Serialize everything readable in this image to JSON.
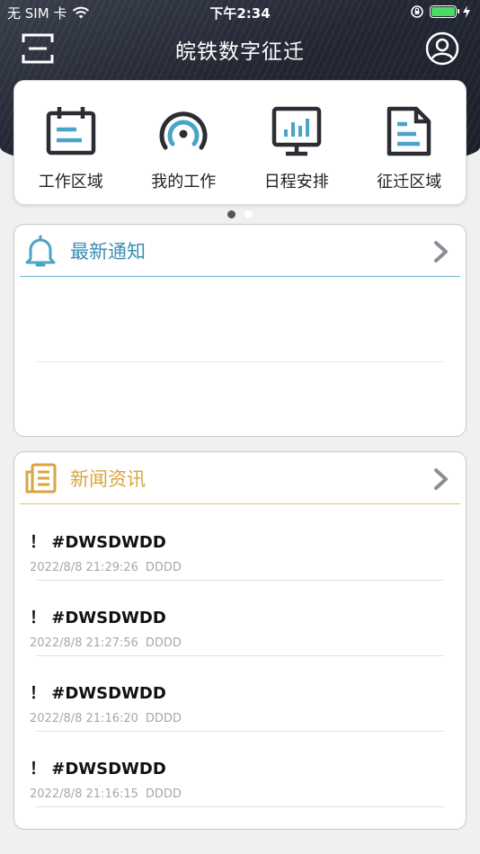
{
  "status_bar": {
    "carrier": "无 SIM 卡",
    "time": "下午2:34"
  },
  "nav": {
    "title": "皖铁数字征迁"
  },
  "quick_menu": [
    {
      "label": "工作区域",
      "icon": "calendar-board-icon"
    },
    {
      "label": "我的工作",
      "icon": "signal-gauge-icon"
    },
    {
      "label": "日程安排",
      "icon": "monitor-chart-icon"
    },
    {
      "label": "征迁区域",
      "icon": "document-icon"
    }
  ],
  "pager": {
    "count": 2,
    "active": 0
  },
  "notice": {
    "title": "最新通知",
    "icon": "bell-icon",
    "items": []
  },
  "news": {
    "title": "新闻资讯",
    "icon": "newspaper-icon",
    "items": [
      {
        "title": "！ #DWSDWDD",
        "date": "2022/8/8 21:29:26",
        "author": "DDDD"
      },
      {
        "title": "！ #DWSDWDD",
        "date": "2022/8/8 21:27:56",
        "author": "DDDD"
      },
      {
        "title": "！ #DWSDWDD",
        "date": "2022/8/8 21:16:20",
        "author": "DDDD"
      },
      {
        "title": "！ #DWSDWDD",
        "date": "2022/8/8 21:16:15",
        "author": "DDDD"
      }
    ]
  },
  "colors": {
    "accent_blue": "#3d8db5",
    "accent_gold": "#d9a53f",
    "icon_blue": "#4aa3c9",
    "icon_dark": "#2a2d33",
    "battery_green": "#4cd964"
  }
}
